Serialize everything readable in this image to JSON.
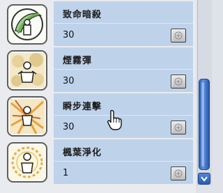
{
  "skills": [
    {
      "name": "致命暗殺",
      "level": "30",
      "icon": "fatal-assassination-icon"
    },
    {
      "name": "煙霧彈",
      "level": "30",
      "icon": "smoke-bomb-icon"
    },
    {
      "name": "瞬步連擊",
      "level": "30",
      "icon": "flash-step-combo-icon"
    },
    {
      "name": "楓葉淨化",
      "level": "1",
      "icon": "maple-purification-icon"
    }
  ],
  "colors": {
    "row_background": "#bed2ea",
    "scroll_thumb": "#3a6fc8"
  },
  "scrollbar": {
    "position_fraction": 0.65
  }
}
